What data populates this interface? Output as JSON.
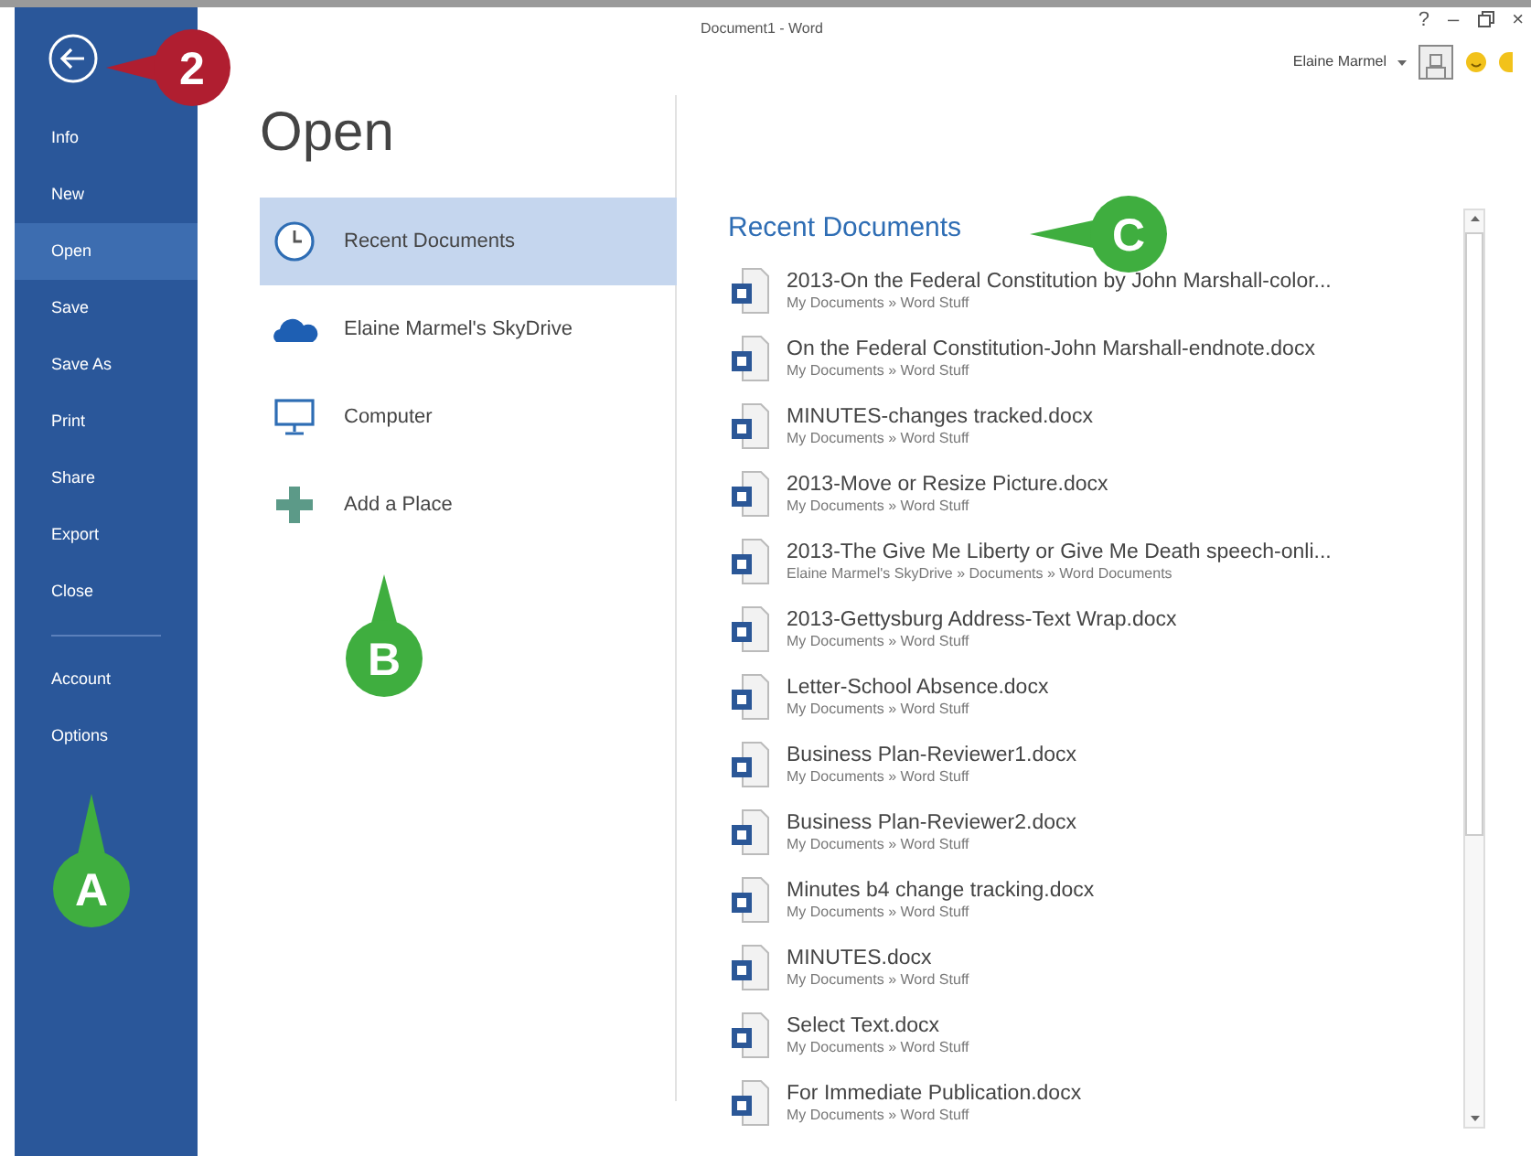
{
  "window": {
    "title": "Document1 - Word",
    "controls": [
      "?",
      "–",
      "×"
    ],
    "user": "Elaine Marmel"
  },
  "sidebar": {
    "items": [
      {
        "label": "Info",
        "selected": false
      },
      {
        "label": "New",
        "selected": false
      },
      {
        "label": "Open",
        "selected": true
      },
      {
        "label": "Save",
        "selected": false
      },
      {
        "label": "Save As",
        "selected": false
      },
      {
        "label": "Print",
        "selected": false
      },
      {
        "label": "Share",
        "selected": false
      },
      {
        "label": "Export",
        "selected": false
      },
      {
        "label": "Close",
        "selected": false
      }
    ],
    "footer_items": [
      {
        "label": "Account",
        "selected": false
      },
      {
        "label": "Options",
        "selected": false
      }
    ]
  },
  "heading": "Open",
  "places": [
    {
      "kind": "recent",
      "label": "Recent Documents",
      "selected": true
    },
    {
      "kind": "cloud",
      "label": "Elaine Marmel's SkyDrive",
      "selected": false
    },
    {
      "kind": "computer",
      "label": "Computer",
      "selected": false
    },
    {
      "kind": "add",
      "label": "Add a Place",
      "selected": false
    }
  ],
  "recent": {
    "title": "Recent Documents",
    "documents": [
      {
        "name": "2013-On the Federal Constitution by John Marshall-color...",
        "path": "My Documents » Word Stuff"
      },
      {
        "name": "On the Federal Constitution-John Marshall-endnote.docx",
        "path": "My Documents » Word Stuff"
      },
      {
        "name": "MINUTES-changes tracked.docx",
        "path": "My Documents » Word Stuff"
      },
      {
        "name": "2013-Move or Resize Picture.docx",
        "path": "My Documents » Word Stuff"
      },
      {
        "name": "2013-The Give Me Liberty or Give Me Death speech-onli...",
        "path": "Elaine Marmel's SkyDrive » Documents » Word Documents"
      },
      {
        "name": "2013-Gettysburg Address-Text Wrap.docx",
        "path": "My Documents » Word Stuff"
      },
      {
        "name": "Letter-School Absence.docx",
        "path": "My Documents » Word Stuff"
      },
      {
        "name": "Business Plan-Reviewer1.docx",
        "path": "My Documents » Word Stuff"
      },
      {
        "name": "Business Plan-Reviewer2.docx",
        "path": "My Documents » Word Stuff"
      },
      {
        "name": "Minutes b4 change tracking.docx",
        "path": "My Documents » Word Stuff"
      },
      {
        "name": "MINUTES.docx",
        "path": "My Documents » Word Stuff"
      },
      {
        "name": "Select Text.docx",
        "path": "My Documents » Word Stuff"
      },
      {
        "name": "For Immediate Publication.docx",
        "path": "My Documents » Word Stuff"
      }
    ]
  },
  "callouts": [
    {
      "label": "2",
      "color": "#b01e30"
    },
    {
      "label": "C",
      "color": "#3fae3f"
    },
    {
      "label": "B",
      "color": "#3fae3f"
    },
    {
      "label": "A",
      "color": "#3fae3f"
    }
  ]
}
